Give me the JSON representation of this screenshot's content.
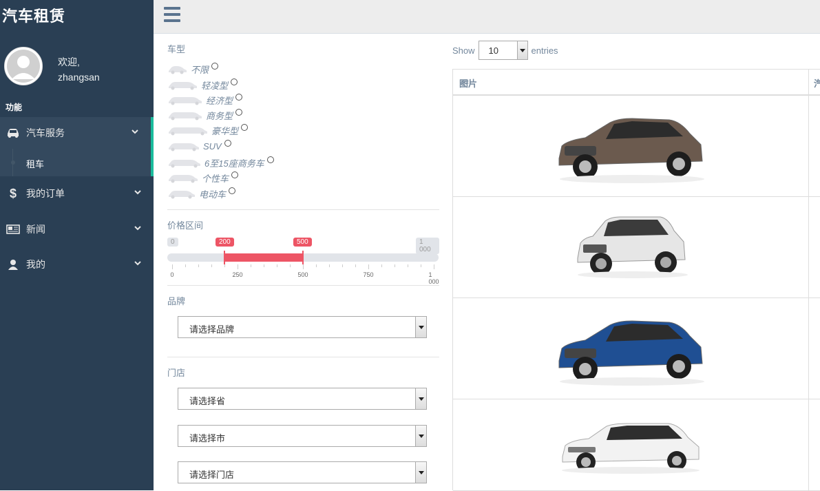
{
  "app": {
    "title": "汽车租赁"
  },
  "user": {
    "greeting": "欢迎,",
    "name": "zhangsan"
  },
  "sidebar": {
    "section_label": "功能",
    "menu": [
      {
        "label": "汽车服务",
        "icon": "car-icon",
        "active": true
      },
      {
        "label": "我的订单",
        "icon": "dollar-icon"
      },
      {
        "label": "新闻",
        "icon": "newspaper-icon"
      },
      {
        "label": "我的",
        "icon": "user-icon"
      }
    ],
    "submenu": [
      {
        "label": "租车"
      }
    ]
  },
  "filters": {
    "car_type_label": "车型",
    "car_types": [
      "不限",
      "轻凌型",
      "经济型",
      "商务型",
      "豪华型",
      "SUV",
      "6至15座商务车",
      "个性车",
      "电动车"
    ],
    "price_label": "价格区间",
    "price": {
      "min": 0,
      "max": 1000,
      "from": 200,
      "to": 500,
      "min_label": "0",
      "max_label": "1 000",
      "from_label": "200",
      "to_label": "500",
      "ticks": [
        "0",
        "250",
        "500",
        "750",
        "1 000"
      ]
    },
    "brand_label": "品牌",
    "brand_placeholder": "请选择品牌",
    "store_label": "门店",
    "province_placeholder": "请选择省",
    "city_placeholder": "请选择市",
    "store_placeholder": "请选择门店"
  },
  "table": {
    "show_label": "Show",
    "entries_value": "10",
    "entries_label": "entries",
    "columns": [
      "图片",
      "汽"
    ],
    "rows": [
      {
        "car": "brown-sedan",
        "color": "#6b5a4e"
      },
      {
        "car": "white-suv",
        "color": "#e6e6e6"
      },
      {
        "car": "blue-sedan",
        "color": "#1f4f93"
      },
      {
        "car": "white-hatchback",
        "color": "#f2f2f2"
      }
    ]
  },
  "colors": {
    "sidebar": "#2a3f54",
    "accent": "#1abb9c",
    "range": "#ed5565"
  }
}
